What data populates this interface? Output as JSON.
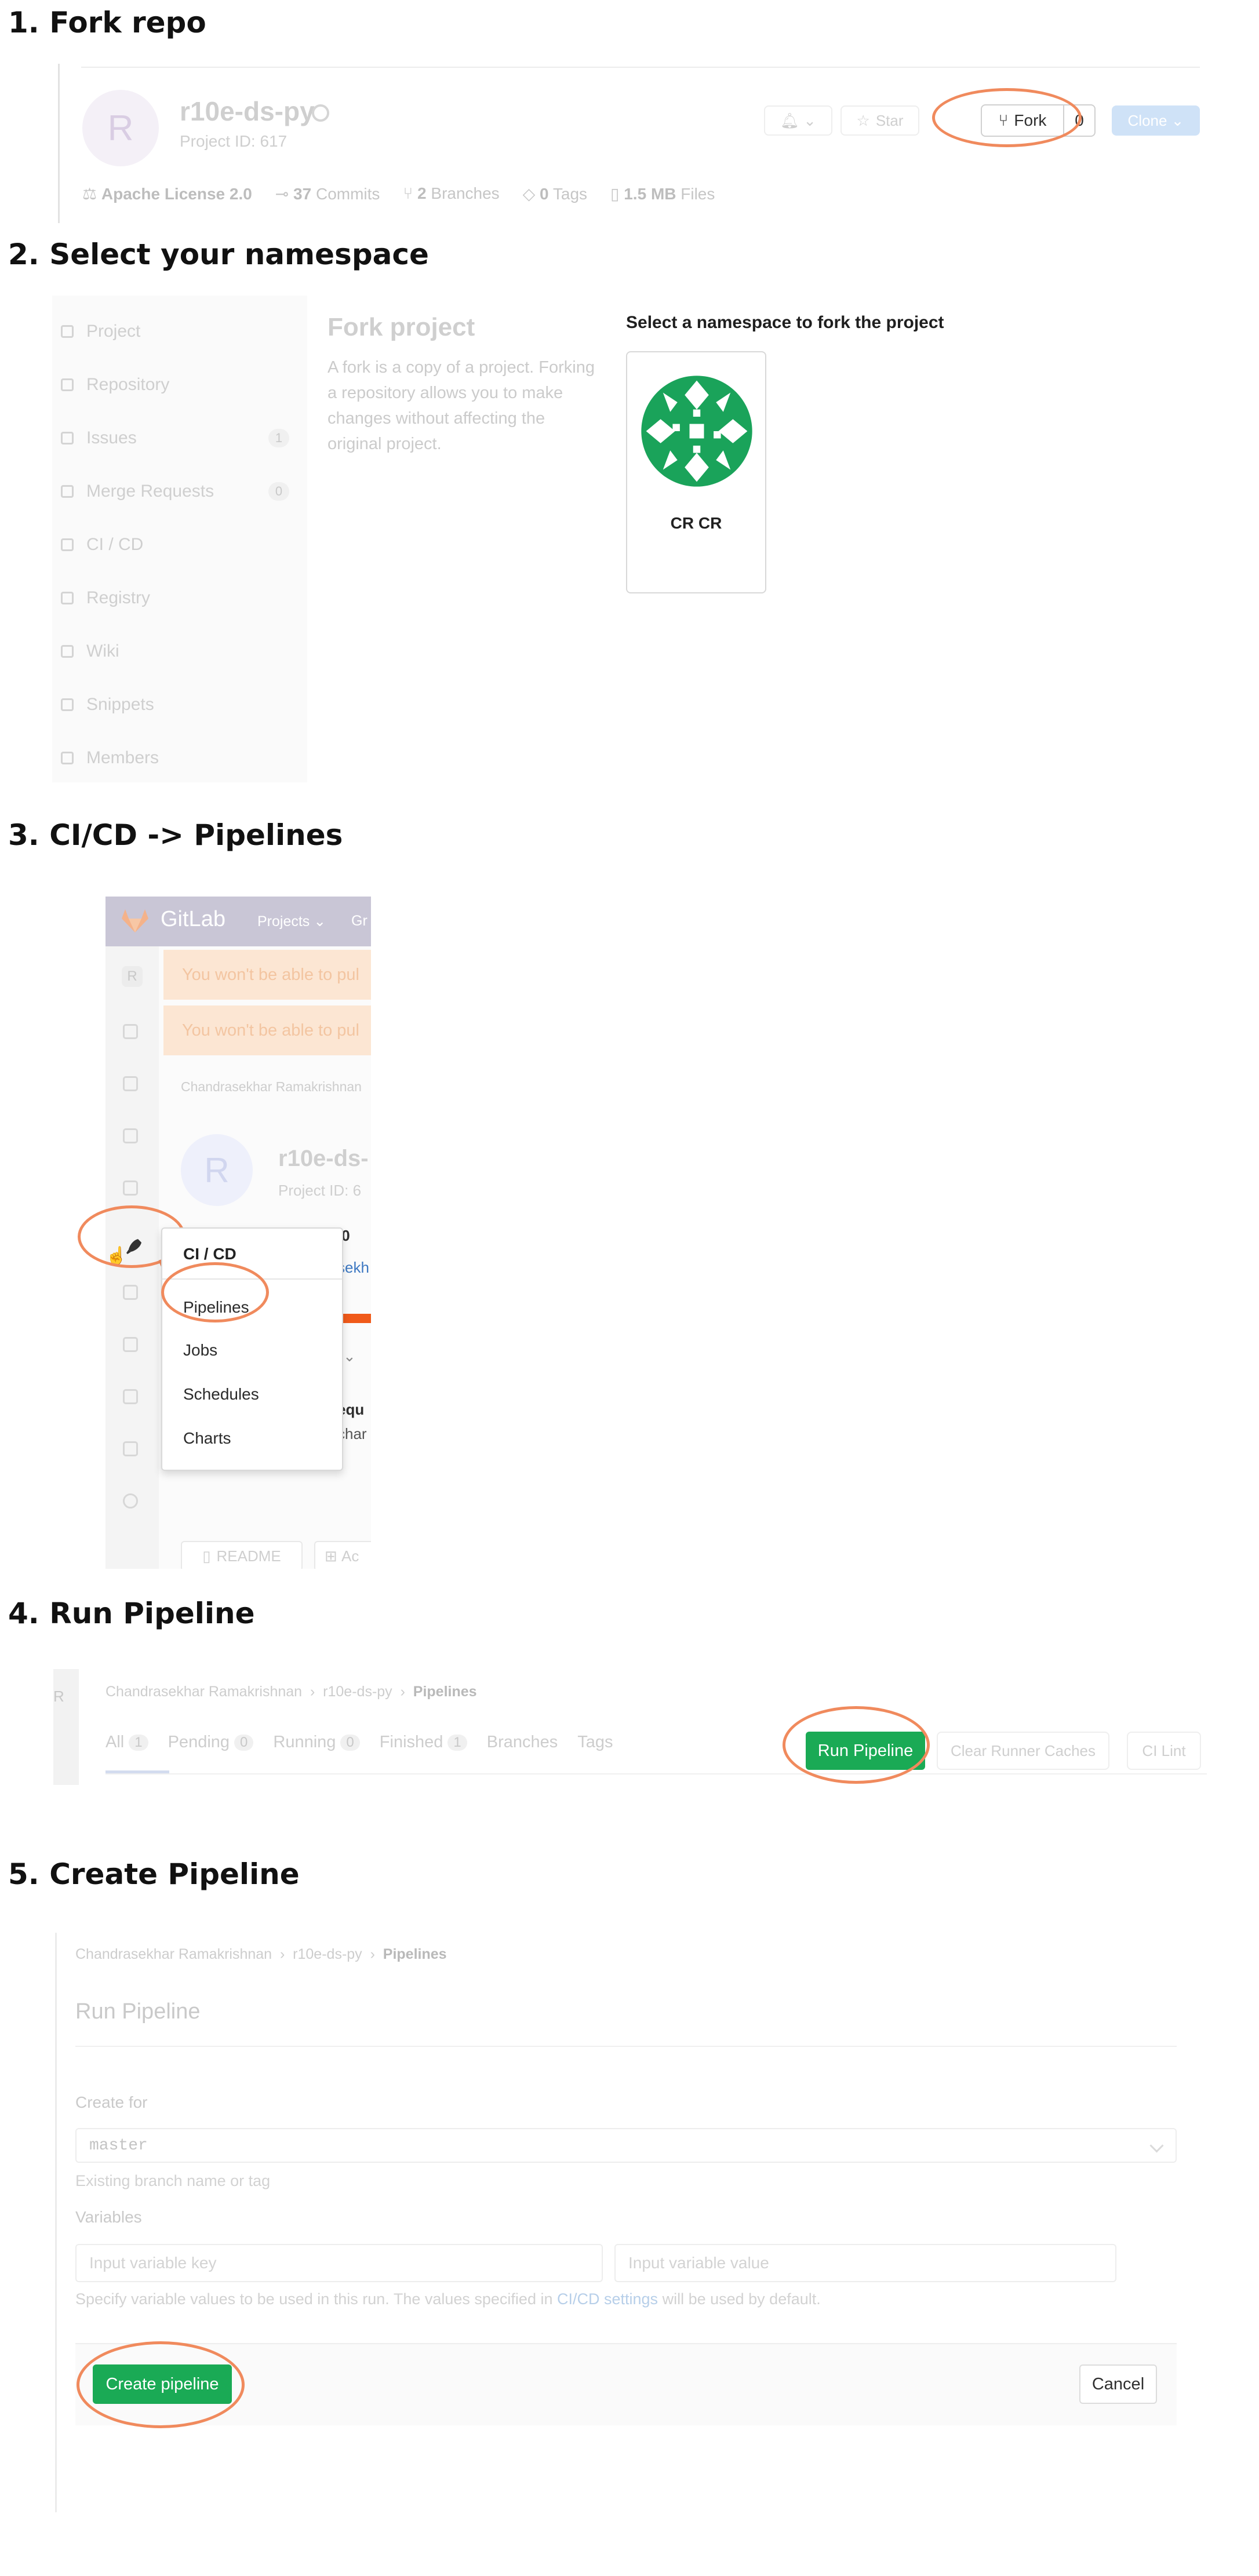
{
  "colors": {
    "accent_ring": "#f08a5d",
    "gitlab_green": "#1aaa55",
    "clone_blue": "#cfe2f7"
  },
  "step1": {
    "heading": "1. Fork repo",
    "project_name": "r10e-ds-py",
    "project_id": "Project ID: 617",
    "notify_icon": "bell-icon",
    "star_label": "Star",
    "fork_label": "Fork",
    "fork_count": "0",
    "clone_label": "Clone",
    "stats": {
      "license": "Apache License 2.0",
      "commits_num": "37",
      "commits_label": "Commits",
      "branches_num": "2",
      "branches_label": "Branches",
      "tags_num": "0",
      "tags_label": "Tags",
      "files_num": "1.5 MB",
      "files_label": "Files"
    }
  },
  "step2": {
    "heading": "2. Select your namespace",
    "sidebar": [
      {
        "label": "Project",
        "icon": "home-icon"
      },
      {
        "label": "Repository",
        "icon": "doc-icon"
      },
      {
        "label": "Issues",
        "icon": "issues-icon",
        "badge": "1"
      },
      {
        "label": "Merge Requests",
        "icon": "merge-icon",
        "badge": "0"
      },
      {
        "label": "CI / CD",
        "icon": "rocket-icon"
      },
      {
        "label": "Registry",
        "icon": "container-icon"
      },
      {
        "label": "Wiki",
        "icon": "book-icon"
      },
      {
        "label": "Snippets",
        "icon": "scissors-icon"
      },
      {
        "label": "Members",
        "icon": "users-icon"
      }
    ],
    "fork_title": "Fork project",
    "fork_description": "A fork is a copy of a project. Forking a repository allows you to make changes without affecting the original project.",
    "namespace_prompt": "Select a namespace to fork the project",
    "namespace_name": "CR CR"
  },
  "step3": {
    "heading": "3. CI/CD -> Pipelines",
    "app_name": "GitLab",
    "nav_projects": "Projects",
    "nav_groups_partial": "Gr",
    "warning_text": "You won't be able to pul",
    "breadcrumb_partial": "Chandrasekhar Ramakrishnan",
    "avatar_letter": "R",
    "project_name_partial": "r10e-ds-",
    "project_id_partial": "Project ID: 6",
    "flyout": {
      "title": "CI / CD",
      "items": [
        "Pipelines",
        "Jobs",
        "Schedules",
        "Charts"
      ]
    },
    "readme_label": "README",
    "add_label_partial": "Ac",
    "side_fragments": {
      "a": ".0",
      "b": "sekh",
      "c": "equ",
      "d": "char"
    }
  },
  "step4": {
    "heading": "4. Run Pipeline",
    "breadcrumb": {
      "user": "Chandrasekhar Ramakrishnan",
      "project": "r10e-ds-py",
      "page": "Pipelines"
    },
    "tabs": [
      {
        "label": "All",
        "count": "1"
      },
      {
        "label": "Pending",
        "count": "0"
      },
      {
        "label": "Running",
        "count": "0"
      },
      {
        "label": "Finished",
        "count": "1"
      },
      {
        "label": "Branches",
        "count": ""
      },
      {
        "label": "Tags",
        "count": ""
      }
    ],
    "run_label": "Run Pipeline",
    "clear_label": "Clear Runner Caches",
    "lint_label": "CI Lint",
    "rail_letter": "R"
  },
  "step5": {
    "heading": "5. Create Pipeline",
    "breadcrumb": {
      "user": "Chandrasekhar Ramakrishnan",
      "project": "r10e-ds-py",
      "page": "Pipelines"
    },
    "title": "Run Pipeline",
    "create_for_label": "Create for",
    "branch_value": "master",
    "branch_hint": "Existing branch name or tag",
    "variables_label": "Variables",
    "key_placeholder": "Input variable key",
    "value_placeholder": "Input variable value",
    "help_prefix": "Specify variable values to be used in this run. The values specified in",
    "help_link": "CI/CD settings",
    "help_suffix": "will be used by default.",
    "create_label": "Create pipeline",
    "cancel_label": "Cancel"
  }
}
